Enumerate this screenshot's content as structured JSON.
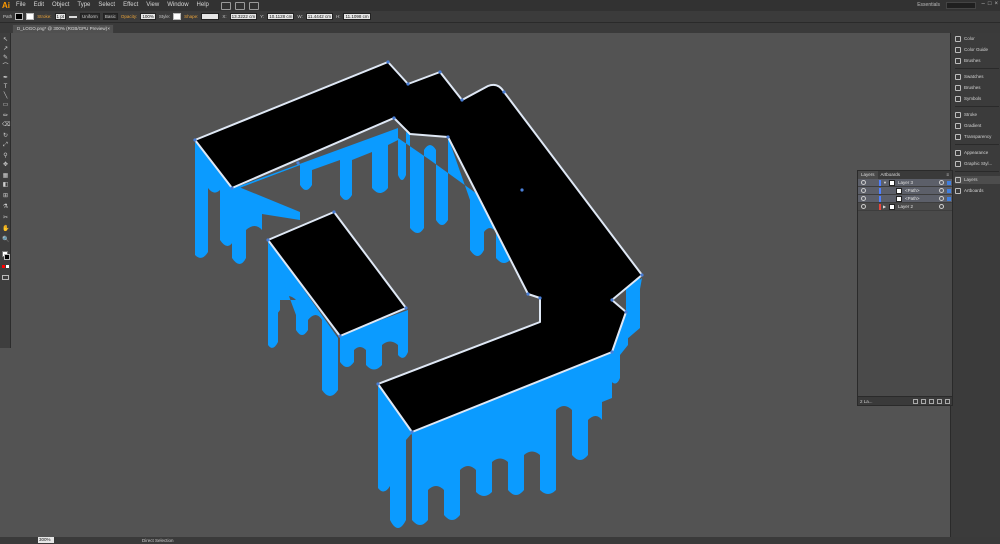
{
  "app": {
    "logo": "Ai"
  },
  "menu": [
    "File",
    "Edit",
    "Object",
    "Type",
    "Select",
    "Effect",
    "View",
    "Window",
    "Help"
  ],
  "menu_icons": [
    "bridge-icon",
    "arrange-documents-icon",
    "gpu-rocket-icon"
  ],
  "workspace": {
    "label": "Essentials"
  },
  "window_buttons": [
    "–",
    "□",
    "×"
  ],
  "control_bar": {
    "selection_label": "Path",
    "stroke_label": "Stroke:",
    "stroke_weight": "1 pt",
    "profile_label": "Uniform",
    "brush_label": "Basic",
    "opacity_label": "Opacity:",
    "opacity_value": "100%",
    "style_label": "Style:",
    "shape_label": "Shape:",
    "x_label": "X:",
    "x_value": "13.3222 cm",
    "y_label": "Y:",
    "y_value": "10.1128 cm",
    "w_label": "W:",
    "w_value": "11.4442 cm",
    "h_label": "H:",
    "h_value": "11.1098 cm"
  },
  "document_tab": {
    "title": "D_LOGO.png* @ 300% (RGB/GPU Preview)",
    "close": "×"
  },
  "tools": [
    "↖",
    "↗",
    "✎",
    "⌒",
    "✒",
    "T",
    "╲",
    "▭",
    "✏",
    "⌫",
    "↻",
    "⤢",
    "⚲",
    "✥",
    "▦",
    "◧",
    "⊞",
    "⚗",
    "✂",
    "✋",
    "🔍"
  ],
  "artwork": {
    "fill_color": "#000000",
    "extrusion_color": "#0b9bff",
    "outline_color": "#dfe8f5",
    "anchor_color": "#4a7fd8"
  },
  "status_bar": {
    "zoom": "300%",
    "mode": "Direct Selection"
  },
  "right_dock": [
    {
      "label": "Color",
      "icon": "color-icon"
    },
    {
      "label": "Color Guide",
      "icon": "color-guide-icon"
    },
    {
      "label": "Brushes",
      "icon": "brushes-icon"
    },
    {
      "label": "Swatches",
      "icon": "swatches-icon"
    },
    {
      "label": "Brushes",
      "icon": "brushes-icon"
    },
    {
      "label": "Symbols",
      "icon": "symbols-icon"
    },
    {
      "label": "Stroke",
      "icon": "stroke-icon"
    },
    {
      "label": "Gradient",
      "icon": "gradient-icon"
    },
    {
      "label": "Transparency",
      "icon": "transparency-icon"
    },
    {
      "label": "Appearance",
      "icon": "appearance-icon"
    },
    {
      "label": "Graphic Styl...",
      "icon": "graphic-styles-icon"
    },
    {
      "label": "Layers",
      "icon": "layers-icon"
    },
    {
      "label": "Artboards",
      "icon": "artboards-icon"
    }
  ],
  "layers_panel": {
    "tabs": [
      "Layers",
      "Artboards"
    ],
    "rows": [
      {
        "name": "Layer 3",
        "color": "#4f80ff",
        "selected": true
      },
      {
        "name": "<Path>",
        "color": "#4f80ff",
        "selected": true
      },
      {
        "name": "<Path>",
        "color": "#4f80ff",
        "selected": true
      },
      {
        "name": "Layer 2",
        "color": "#e8463b",
        "selected": false
      }
    ],
    "footer": "2 La..."
  }
}
